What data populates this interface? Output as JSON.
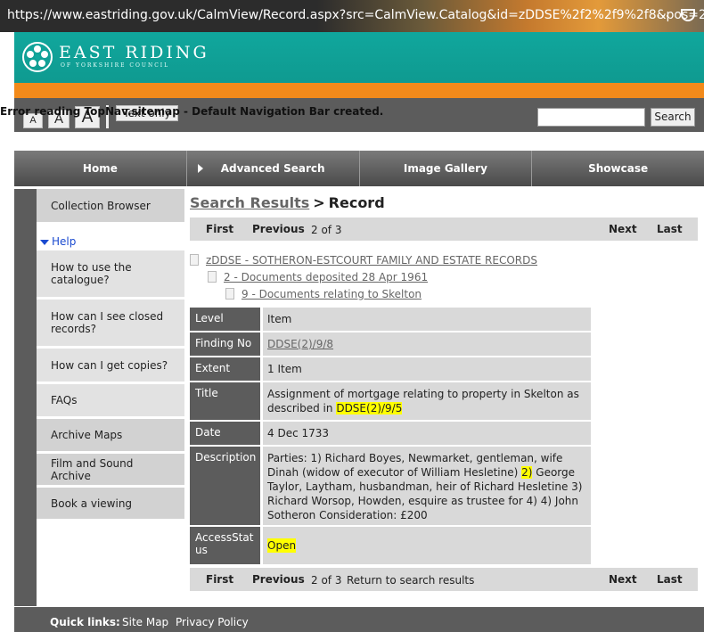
{
  "browser": {
    "url": "https://www.eastriding.gov.uk/CalmView/Record.aspx?src=CalmView.Catalog&id=zDDSE%2f2%2f9%2f8&pos=2",
    "menu_icon": "⋯"
  },
  "site": {
    "name": "EAST RIDING",
    "subtitle": "OF YORKSHIRE COUNCIL",
    "text_sizes": [
      "A",
      "A",
      "A"
    ],
    "text_only": "Text only",
    "search_placeholder": "",
    "search_button": "Search",
    "error": "Error reading TopNav.sitemap - Default Navigation Bar created."
  },
  "topnav": [
    "Home",
    "Advanced Search",
    "Image Gallery",
    "Showcase"
  ],
  "sidebar": {
    "items": [
      {
        "label": "Collection Browser"
      },
      {
        "label": "Help"
      },
      {
        "label": "How to use the catalogue?"
      },
      {
        "label": "How can I see closed records?"
      },
      {
        "label": "How can I get copies?"
      },
      {
        "label": "FAQs"
      },
      {
        "label": "Archive Maps"
      },
      {
        "label": "Film and Sound Archive"
      },
      {
        "label": "Book a viewing"
      }
    ]
  },
  "breadcrumb": {
    "link": "Search Results",
    "sep": ">",
    "current": "Record"
  },
  "pager": {
    "first": "First",
    "previous": "Previous",
    "count": "2 of 3",
    "return": "Return to search results",
    "next": "Next",
    "last": "Last"
  },
  "tree": [
    "zDDSE - SOTHERON-ESTCOURT FAMILY AND ESTATE RECORDS",
    "2 - Documents deposited 28 Apr 1961",
    "9 - Documents relating to Skelton"
  ],
  "record": {
    "level_label": "Level",
    "level": "Item",
    "finding_label": "Finding No",
    "finding": "DDSE(2)/9/8",
    "extent_label": "Extent",
    "extent": "1 Item",
    "title_label": "Title",
    "title_text": "Assignment of mortgage relating to property in Skelton as described in",
    "title_ref": "DDSE(2)/9/5",
    "date_label": "Date",
    "date": "4 Dec 1733",
    "desc_label": "Description",
    "desc_a": "Parties: 1) Richard Boyes, Newmarket, gentleman, wife Dinah (widow of executor of William Hesletine)",
    "desc_hl": "2)",
    "desc_b": "George Taylor, Laytham, husbandman, heir of Richard Hesletine 3) Richard Worsop, Howden, esquire as trustee for 4) 4) John Sotheron Consideration: £200",
    "access_label": "AccessStatus",
    "access": "Open"
  },
  "footer": {
    "quick": "Quick links:",
    "sitemap": "Site Map",
    "privacy": "Privacy Policy"
  },
  "colors": {
    "teal": "#10a79d",
    "orange": "#f28a1a",
    "grey": "#5c5c5c",
    "highlight": "#ffff00"
  }
}
